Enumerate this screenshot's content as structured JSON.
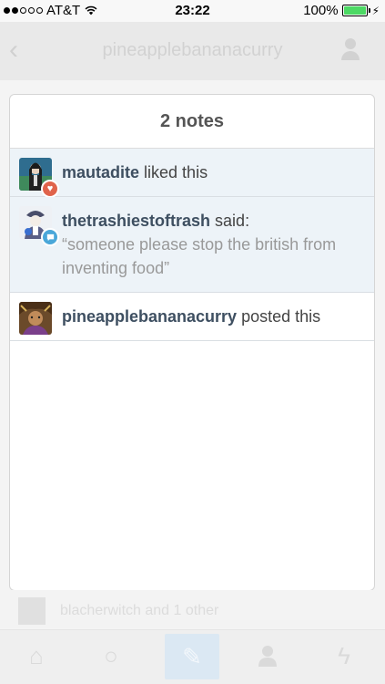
{
  "status_bar": {
    "carrier": "AT&T",
    "time": "23:22",
    "battery_percent": "100%",
    "signal_dots_filled": 2,
    "signal_dots_total": 5
  },
  "background_app": {
    "nav_title": "pineapplebananacurry",
    "row_text": "blacherwitch and 1 other"
  },
  "notes_modal": {
    "title": "2 notes",
    "notes": [
      {
        "username": "mautadite",
        "action": " liked this",
        "badge": "like-icon",
        "highlighted": true
      },
      {
        "username": "thetrashiestoftrash",
        "action": " said:",
        "quote": "“someone please stop the british from inventing food”",
        "badge": "reply-icon",
        "highlighted": true
      },
      {
        "username": "pineapplebananacurry",
        "action": " posted this",
        "highlighted": false
      }
    ]
  },
  "colors": {
    "username": "#3e4f61",
    "like_badge": "#e0634b",
    "reply_badge": "#4aa7d9",
    "highlight_row": "#edf3f8",
    "battery": "#4cd964"
  }
}
